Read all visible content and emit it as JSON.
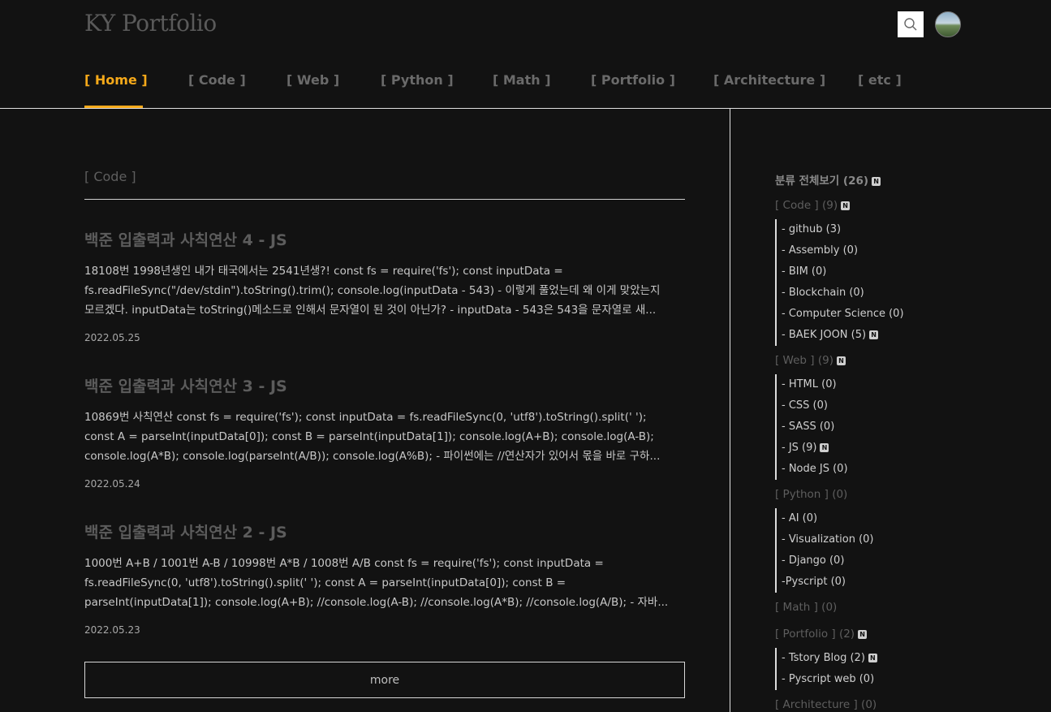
{
  "header": {
    "logo": "KY Portfolio",
    "nav": [
      {
        "label": "[ Home ]",
        "active": true
      },
      {
        "label": "[ Code ]"
      },
      {
        "label": "[ Web ]"
      },
      {
        "label": "[ Python ]"
      },
      {
        "label": "[ Math ]"
      },
      {
        "label": "[ Portfolio ]"
      },
      {
        "label": "[ Architecture ]"
      },
      {
        "label": "[ etc ]"
      }
    ],
    "search_icon": "search-icon",
    "avatar_icon": "profile-avatar"
  },
  "main": {
    "section_title": "[ Code ]",
    "posts": [
      {
        "title": "백준 입출력과 사칙연산 4 - JS",
        "excerpt": "18108번 1998년생인 내가 태국에서는 2541년생?! const fs = require('fs'); const inputData = fs.readFileSync(\"/dev/stdin\").toString().trim(); console.log(inputData - 543) - 이렇게 풀었는데 왜 이게 맞았는지 모르겠다. inputData는 toString()메소드로 인해서 문자열이 된 것이 아닌가? - inputData - 543은 543을 문자열로 새...",
        "date": "2022.05.25"
      },
      {
        "title": "백준 입출력과 사칙연산 3 - JS",
        "excerpt": "10869번 사칙연산 const fs = require('fs'); const inputData = fs.readFileSync(0, 'utf8').toString().split(' '); const A = parseInt(inputData[0]); const B = parseInt(inputData[1]); console.log(A+B); console.log(A-B); console.log(A*B); console.log(parseInt(A/B)); console.log(A%B); - 파이썬에는 //연산자가 있어서 몫을 바로 구하...",
        "date": "2022.05.24"
      },
      {
        "title": "백준 입출력과 사칙연산 2 - JS",
        "excerpt": "1000번 A+B / 1001번 A-B / 10998번 A*B / 1008번 A/B const fs = require('fs'); const inputData = fs.readFileSync(0, 'utf8').toString().split(' '); const A = parseInt(inputData[0]); const B = parseInt(inputData[1]); console.log(A+B); //console.log(A-B); //console.log(A*B); //console.log(A/B); - 자바...",
        "date": "2022.05.23"
      }
    ],
    "more_label": "more"
  },
  "sidebar": {
    "all_label": "분류 전체보기 (26)",
    "new_badge": "N",
    "categories": [
      {
        "label": "[ Code ] (9)",
        "new": true,
        "subs": [
          {
            "label": "- github (3)"
          },
          {
            "label": "- Assembly (0)"
          },
          {
            "label": "- BIM (0)"
          },
          {
            "label": "- Blockchain (0)"
          },
          {
            "label": "- Computer Science (0)"
          },
          {
            "label": "- BAEK JOON (5)",
            "new": true
          }
        ]
      },
      {
        "label": "[ Web ] (9)",
        "new": true,
        "subs": [
          {
            "label": "- HTML (0)"
          },
          {
            "label": "- CSS (0)"
          },
          {
            "label": "- SASS (0)"
          },
          {
            "label": "- JS (9)",
            "new": true
          },
          {
            "label": "- Node JS (0)"
          }
        ]
      },
      {
        "label": "[ Python ] (0)",
        "subs": [
          {
            "label": "- AI (0)"
          },
          {
            "label": "- Visualization (0)"
          },
          {
            "label": "- Django (0)"
          },
          {
            "label": "-Pyscript (0)"
          }
        ]
      },
      {
        "label": "[ Math ] (0)",
        "subs": []
      },
      {
        "label": "[ Portfolio ] (2)",
        "new": true,
        "subs": [
          {
            "label": "- Tstory Blog (2)",
            "new": true
          },
          {
            "label": "- Pyscript web (0)"
          }
        ]
      },
      {
        "label": "[ Architecture ] (0)",
        "subs": []
      }
    ]
  }
}
